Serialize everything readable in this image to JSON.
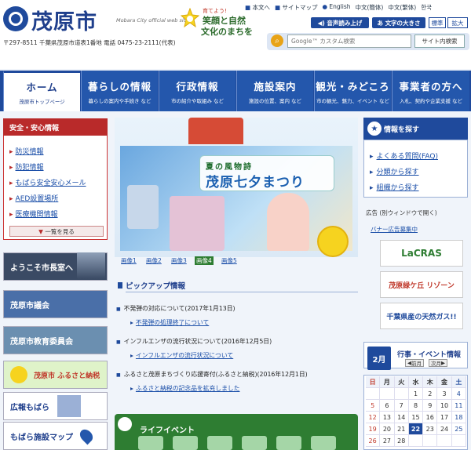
{
  "header": {
    "logo_name": "茂原市",
    "logo_sub": "Mobara City official web site",
    "address": "〒297-8511 千葉県茂原市道表1番地 電話 0475-23-2111(代表)",
    "slogan_small": "育てよう!",
    "slogan1": "笑顔と自然",
    "slogan2": "文化のまちを",
    "toplinks": [
      {
        "icon": "house-icon",
        "label": "本文へ"
      },
      {
        "icon": "sitemap-icon",
        "label": "サイトマップ"
      },
      {
        "icon": "globe-icon",
        "label": "English"
      },
      {
        "label": "中文(簡体)"
      },
      {
        "label": "中文(繁体)"
      },
      {
        "label": "한국"
      }
    ],
    "voice_label": "音声読み上げ",
    "textsize_label": "文字の大きさ",
    "size_std": "標準",
    "size_big": "拡大",
    "search_placeholder": "Google™ カスタム検索",
    "search_button": "サイト内検索"
  },
  "nav": [
    {
      "label": "ホーム",
      "sub": "茂原市トップページ",
      "active": true
    },
    {
      "label": "暮らしの情報",
      "sub": "暮らしの案内や手続き など"
    },
    {
      "label": "行政情報",
      "sub": "市の紹介や取組み など"
    },
    {
      "label": "施設案内",
      "sub": "施設の位置、案内 など"
    },
    {
      "label": "観光・みどころ",
      "sub": "市の観光、魅力、イベント など"
    },
    {
      "label": "事業者の方へ",
      "sub": "入札、契約や企業支援 など"
    }
  ],
  "safety": {
    "title": "安全・安心情報",
    "items": [
      "防災情報",
      "防犯情報",
      "もばら安全安心メール",
      "AED設置場所",
      "医療機関情報"
    ],
    "more": "一覧を見る"
  },
  "left_banners": [
    {
      "label": "ようこそ市長室へ",
      "color": "#3a4a64"
    },
    {
      "label": "茂原市議会",
      "color": "#4a6fa8"
    },
    {
      "label": "茂原市教育委員会",
      "color": "#6b8fb0"
    },
    {
      "label": "茂原市 ふるさと納税",
      "color": "#d9f0c8"
    },
    {
      "label": "広報もばら",
      "color": "#ffffff"
    },
    {
      "label": "もばら施設マップ",
      "color": "#ffffff"
    }
  ],
  "hero": {
    "sub": "夏の風物詩",
    "title": "茂原七夕まつり",
    "tabs": [
      "画像1",
      "画像2",
      "画像3",
      "画像4",
      "画像5"
    ],
    "active_tab": 3
  },
  "pickup": {
    "title": "ピックアップ情報",
    "items": [
      {
        "text": "不発弾の対応について(2017年1月13日)",
        "link": "不発弾の処理終了について"
      },
      {
        "text": "インフルエンザの流行状況について(2016年12月5日)",
        "link": "インフルエンザの流行状況について"
      },
      {
        "text": "ふるさと茂原まちづくり応援寄付(ふるさと納税)(2016年12月1日)",
        "link": "ふるさと納税の記念品を拡充しました"
      }
    ]
  },
  "life_event": {
    "title": "ライフイベント"
  },
  "info": {
    "title": "情報を探す",
    "items": [
      "よくある質問(FAQ)",
      "分類から探す",
      "組織から探す"
    ]
  },
  "ads": {
    "label": "広告 (別ウィンドウで開く)",
    "link": "バナー広告募集中",
    "items": [
      {
        "label": "LaCRAS",
        "color": "#2e7d32"
      },
      {
        "label": "茂原緑ケ丘 リゾーン",
        "color": "#c0392b"
      },
      {
        "label": "千葉県産の天然ガス!!",
        "color": "#1f4a9c"
      }
    ]
  },
  "calendar": {
    "month": "2月",
    "title": "行事・イベント情報",
    "prev": "前月",
    "next": "次月",
    "weekdays": [
      "日",
      "月",
      "火",
      "水",
      "木",
      "金",
      "土"
    ],
    "rows": [
      [
        "",
        "",
        "",
        "1",
        "2",
        "3",
        "4"
      ],
      [
        "5",
        "6",
        "7",
        "8",
        "9",
        "10",
        "11"
      ],
      [
        "12",
        "13",
        "14",
        "15",
        "16",
        "17",
        "18"
      ],
      [
        "19",
        "20",
        "21",
        "22",
        "23",
        "24",
        "25"
      ],
      [
        "26",
        "27",
        "28",
        "",
        "",
        "",
        ""
      ]
    ],
    "today": "22"
  },
  "colors": {
    "primary": "#1f4a9c",
    "safety": "#b92a2a",
    "life": "#2e7d32"
  }
}
